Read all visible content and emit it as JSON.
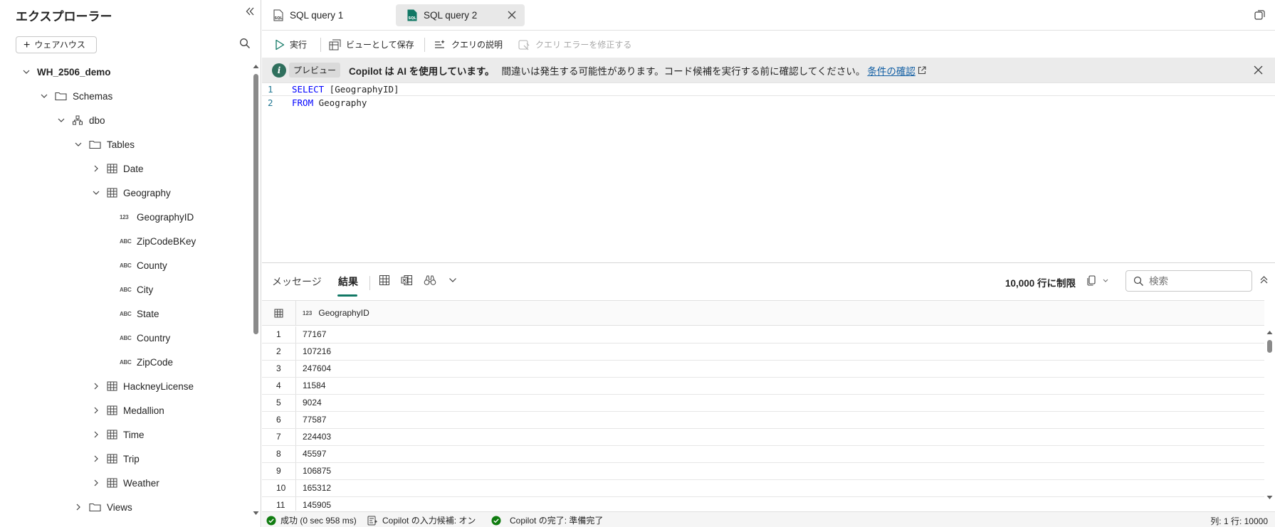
{
  "explorer": {
    "title": "エクスプローラー",
    "add_label": "ウェアハウス",
    "tree": [
      {
        "label": "WH_2506_demo",
        "bold": true
      },
      {
        "label": "Schemas"
      },
      {
        "label": "dbo"
      },
      {
        "label": "Tables"
      },
      {
        "label": "Date"
      },
      {
        "label": "Geography"
      },
      {
        "label": "GeographyID",
        "badge": "123"
      },
      {
        "label": "ZipCodeBKey",
        "badge": "ABC"
      },
      {
        "label": "County",
        "badge": "ABC"
      },
      {
        "label": "City",
        "badge": "ABC"
      },
      {
        "label": "State",
        "badge": "ABC"
      },
      {
        "label": "Country",
        "badge": "ABC"
      },
      {
        "label": "ZipCode",
        "badge": "ABC"
      },
      {
        "label": "HackneyLicense"
      },
      {
        "label": "Medallion"
      },
      {
        "label": "Time"
      },
      {
        "label": "Trip"
      },
      {
        "label": "Weather"
      },
      {
        "label": "Views"
      }
    ]
  },
  "tabs": [
    {
      "label": "SQL query 1"
    },
    {
      "label": "SQL query 2"
    }
  ],
  "toolbar": {
    "run": "実行",
    "save_as_view": "ビューとして保存",
    "explain_query": "クエリの説明",
    "fix_query_errors": "クエリ エラーを修正する"
  },
  "banner": {
    "preview": "プレビュー",
    "headline": "Copilot は AI を使用しています。",
    "message": "間違いは発生する可能性があります。コード候補を実行する前に確認してください。",
    "link": "条件の確認"
  },
  "editor": {
    "lines": [
      {
        "num": "1",
        "keyword": "SELECT",
        "rest": " [GeographyID]"
      },
      {
        "num": "2",
        "keyword": "FROM",
        "rest": " Geography"
      }
    ]
  },
  "results": {
    "tab_messages": "メッセージ",
    "tab_results": "結果",
    "row_limit": "10,000 行に制限",
    "search_placeholder": "検索",
    "column_badge": "123",
    "column": "GeographyID",
    "rows": [
      {
        "idx": "1",
        "val": "77167"
      },
      {
        "idx": "2",
        "val": "107216"
      },
      {
        "idx": "3",
        "val": "247604"
      },
      {
        "idx": "4",
        "val": "11584"
      },
      {
        "idx": "5",
        "val": "9024"
      },
      {
        "idx": "6",
        "val": "77587"
      },
      {
        "idx": "7",
        "val": "224403"
      },
      {
        "idx": "8",
        "val": "45597"
      },
      {
        "idx": "9",
        "val": "106875"
      },
      {
        "idx": "10",
        "val": "165312"
      },
      {
        "idx": "11",
        "val": "145905"
      }
    ]
  },
  "status": {
    "success": "成功 (0 sec 958 ms)",
    "copilot_suggestions": "Copilot の入力候補: オン",
    "copilot_complete": "Copilot の完了: 準備完了",
    "cursor": "列: 1 行: 10000"
  },
  "colors": {
    "accent": "#117865",
    "success": "#107c10",
    "link": "#115ea3",
    "banner_bg": "#ebebeb"
  }
}
